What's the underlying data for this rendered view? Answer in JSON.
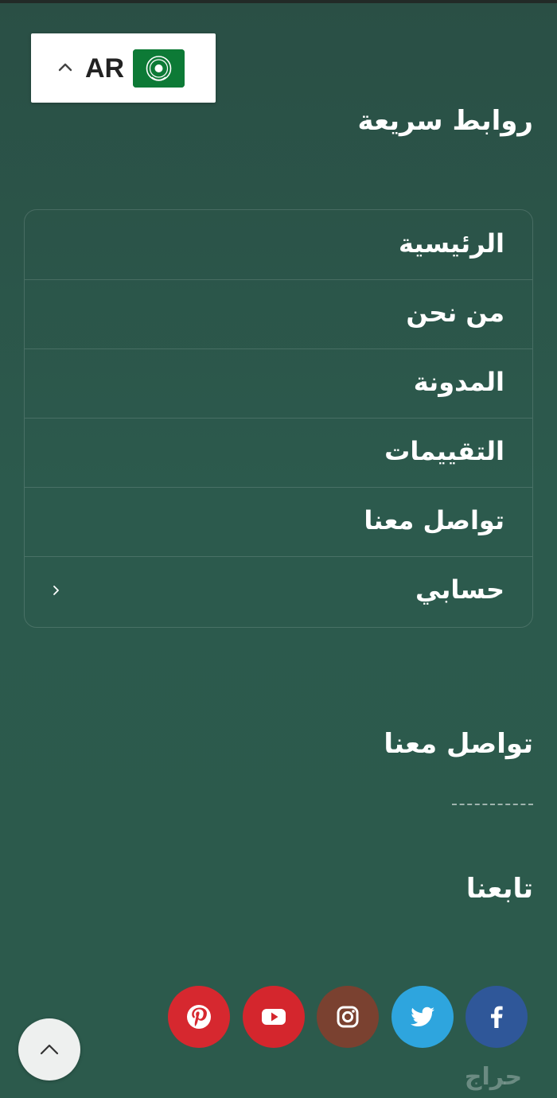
{
  "language_switcher": {
    "code": "AR",
    "flag_icon": "arab-league-flag-icon",
    "chevron_icon": "chevron-up-icon"
  },
  "quick_links": {
    "title": "روابط سريعة",
    "items": [
      {
        "label": "الرئيسية"
      },
      {
        "label": "من نحن"
      },
      {
        "label": "المدونة"
      },
      {
        "label": "التقييمات"
      },
      {
        "label": "تواصل معنا"
      },
      {
        "label": "حسابي",
        "icon": "chevron-right-icon"
      }
    ]
  },
  "contact": {
    "title": "تواصل معنا"
  },
  "follow": {
    "title": "تابعنا",
    "social": [
      {
        "icon": "facebook-icon",
        "color": "#2f5799"
      },
      {
        "icon": "twitter-icon",
        "color": "#2ea5de"
      },
      {
        "icon": "instagram-icon",
        "color": "#7a4130"
      },
      {
        "icon": "youtube-icon",
        "color": "#d4262d"
      },
      {
        "icon": "pinterest-icon",
        "color": "#d6282f"
      }
    ]
  },
  "scroll_top": {
    "icon": "chevron-up-icon"
  },
  "watermark": {
    "text": "حراج"
  },
  "colors": {
    "background": "#2b5548",
    "text": "#ffffff"
  }
}
